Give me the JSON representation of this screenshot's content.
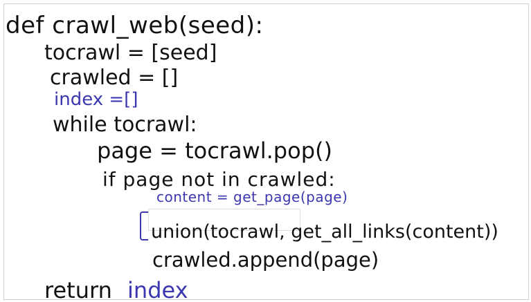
{
  "code": {
    "line1": "def crawl_web(seed):",
    "line2": "tocrawl = [seed]",
    "line3": "crawled = []",
    "line4": "index =[]",
    "line5": "while tocrawl:",
    "line6": "page = tocrawl.pop()",
    "line7": "if page not in crawled:",
    "line8": "content = get_page(page)",
    "line9": "union(tocrawl, get_all_links(content))",
    "line10": "crawled.append(page)",
    "line11_keyword": "return",
    "line11_value": "index"
  },
  "colors": {
    "ink": "#111111",
    "blue_ink": "#3b37b0",
    "background": "#ffffff"
  }
}
